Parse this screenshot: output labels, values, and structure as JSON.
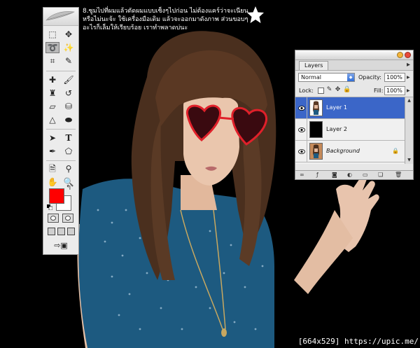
{
  "instruction": {
    "lines": [
      "8.ซูมไปที่ผมแล้วตัดผมแบบเซ็งๆไปก่อน ไม่ต้องแคร์ว่าจะเนียน",
      "หรือไม่นะจ้ะ ใช้เครื่องมือเดิม แล้วจะออกมาดังภาพ ส่วนขอบๆ",
      "อะไรก็เล็มให้เรียบร้อย เราทำพลาดบ่นะ"
    ]
  },
  "star_icon": "star-icon",
  "watermark": "[664x529] https://upic.me/",
  "toolbox": {
    "foreground_color": "#ff0000",
    "background_color": "#ffffff",
    "active_tool": "lasso-tool"
  },
  "layers_panel": {
    "tab": "Layers",
    "blend_mode": "Normal",
    "opacity_label": "Opacity:",
    "opacity": "100%",
    "lock_label": "Lock:",
    "fill_label": "Fill:",
    "fill": "100%",
    "layers": [
      {
        "name": "Layer 1",
        "selected": true
      },
      {
        "name": "Layer 2",
        "selected": false
      },
      {
        "name": "Background",
        "selected": false
      }
    ],
    "selected_color": "#3b66c8"
  }
}
